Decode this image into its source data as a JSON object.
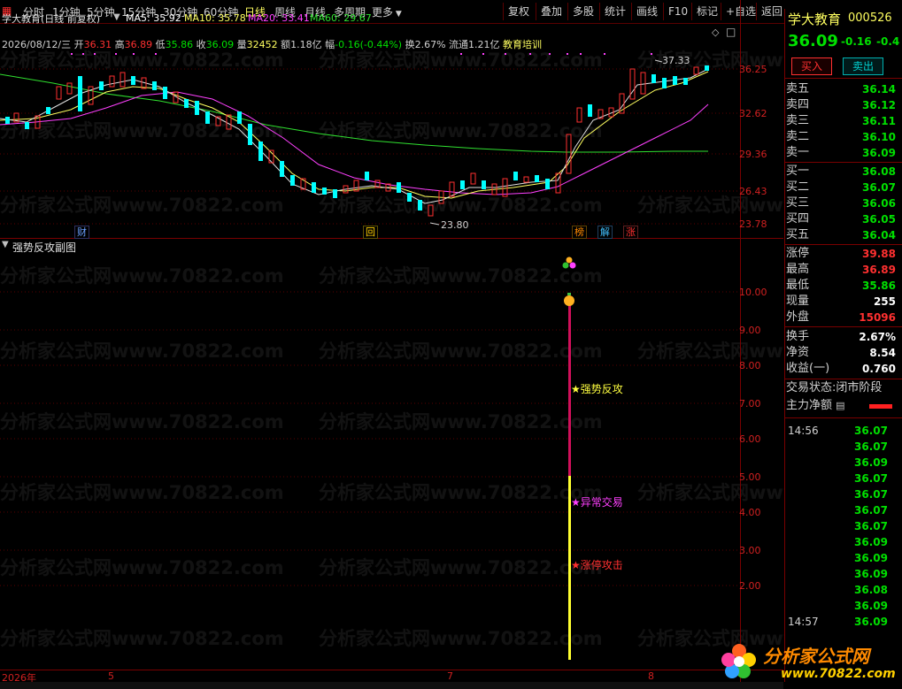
{
  "toolbar": {
    "periods": [
      "分时",
      "1分钟",
      "5分钟",
      "15分钟",
      "30分钟",
      "60分钟",
      "日线",
      "周线",
      "月线",
      "多周期",
      "更多"
    ],
    "active_period": "日线",
    "actions": [
      "复权",
      "叠加",
      "多股",
      "统计",
      "画线",
      "F10",
      "标记",
      "+自选",
      "返回"
    ]
  },
  "chart_header": {
    "title": "学大教育(日线 前复权)",
    "ma5": "MA5: 35.92",
    "ma10": "MA10: 35.78",
    "ma20": "MA20: 33.41",
    "ma60": "MA60: 29.67",
    "info_date": "2026/08/12/三",
    "info_open_label": "开",
    "info_open": "36.31",
    "info_high_label": "高",
    "info_high": "36.89",
    "info_low_label": "低",
    "info_low": "35.86",
    "info_close_label": "收",
    "info_close": "36.09",
    "info_vol_label": "量",
    "info_vol": "32452",
    "info_amount_label": "额",
    "info_amount": "1.18亿",
    "info_chg_label": "幅",
    "info_chg": "-0.16(-0.44%)",
    "info_turnover": "换2.67%",
    "info_float": "流通1.21亿",
    "info_sector": "教育培训"
  },
  "price_axis": [
    "36.25",
    "32.62",
    "29.36",
    "26.43",
    "23.78"
  ],
  "price_annotations": {
    "high": "37.33",
    "low": "23.80"
  },
  "badges": [
    {
      "text": "财",
      "color": "#6aa0ff"
    },
    {
      "text": "回",
      "color": "#ffd000"
    },
    {
      "text": "榜",
      "color": "#ff8a00"
    },
    {
      "text": "解",
      "color": "#40c0ff"
    },
    {
      "text": "涨",
      "color": "#ff3030"
    }
  ],
  "indicator": {
    "title": "强势反攻副图",
    "axis": [
      "10.00",
      "9.00",
      "8.00",
      "7.00",
      "6.00",
      "5.00",
      "4.00",
      "3.00",
      "2.00"
    ],
    "labels": [
      {
        "text": "★强势反攻",
        "color": "#ffff40"
      },
      {
        "text": "★异常交易",
        "color": "#ff40ff"
      },
      {
        "text": "★涨停攻击",
        "color": "#ff3030"
      }
    ]
  },
  "x_axis": [
    "2026年",
    "5",
    "7",
    "8"
  ],
  "watermark": "分析家公式网www.70822.com",
  "logo": {
    "name": "分析家公式网",
    "url": "www.70822.com"
  },
  "quote": {
    "name": "学大教育",
    "code": "000526",
    "price": "36.09",
    "change": "-0.16",
    "change_pct": "-0.4",
    "buy_btn": "买入",
    "sell_btn": "卖出",
    "asks": [
      {
        "label": "卖五",
        "price": "36.14"
      },
      {
        "label": "卖四",
        "price": "36.12"
      },
      {
        "label": "卖三",
        "price": "36.11"
      },
      {
        "label": "卖二",
        "price": "36.10"
      },
      {
        "label": "卖一",
        "price": "36.09"
      }
    ],
    "bids": [
      {
        "label": "买一",
        "price": "36.08"
      },
      {
        "label": "买二",
        "price": "36.07"
      },
      {
        "label": "买三",
        "price": "36.06"
      },
      {
        "label": "买四",
        "price": "36.05"
      },
      {
        "label": "买五",
        "price": "36.04"
      }
    ],
    "stats": [
      {
        "label": "涨停",
        "value": "39.88",
        "color": "#ff3030"
      },
      {
        "label": "最高",
        "value": "36.89",
        "color": "#ff3030"
      },
      {
        "label": "最低",
        "value": "35.86",
        "color": "#00e000"
      },
      {
        "label": "现量",
        "value": "255",
        "color": "#ffffff"
      },
      {
        "label": "外盘",
        "value": "15096",
        "color": "#ff3030"
      }
    ],
    "stats2": [
      {
        "label": "换手",
        "value": "2.67%",
        "color": "#ffffff"
      },
      {
        "label": "净资",
        "value": "8.54",
        "color": "#ffffff"
      },
      {
        "label": "收益(一)",
        "value": "0.760",
        "color": "#ffffff"
      }
    ],
    "status_label": "交易状态:",
    "status_value": "闭市阶段",
    "main_flow_label": "主力净额",
    "ticks": [
      {
        "time": "14:56",
        "value": "36.07"
      },
      {
        "time": "",
        "value": "36.07"
      },
      {
        "time": "",
        "value": "36.09"
      },
      {
        "time": "",
        "value": "36.07"
      },
      {
        "time": "",
        "value": "36.07"
      },
      {
        "time": "",
        "value": "36.07"
      },
      {
        "time": "",
        "value": "36.07"
      },
      {
        "time": "",
        "value": "36.09"
      },
      {
        "time": "",
        "value": "36.09"
      },
      {
        "time": "",
        "value": "36.09"
      },
      {
        "time": "",
        "value": "36.08"
      },
      {
        "time": "",
        "value": "36.09"
      },
      {
        "time": "14:57",
        "value": "36.09"
      }
    ]
  },
  "colors": {
    "up": "#ff3030",
    "down": "#00ffff",
    "ma5": "#ffffff",
    "ma10": "#ffff60",
    "ma20": "#ff40ff",
    "ma60": "#30e030",
    "grid": "#7a0000"
  }
}
